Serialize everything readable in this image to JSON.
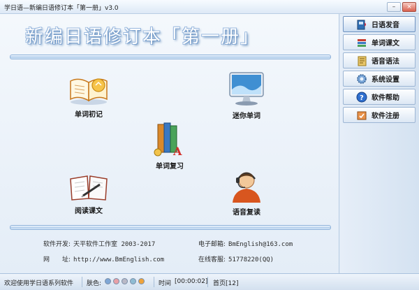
{
  "window": {
    "title": "学日语—新编日语修订本「第一册」v3.0"
  },
  "banner": {
    "text": "新编日语修订本「第一册」"
  },
  "tiles": {
    "word_learn": "单词初记",
    "mini_words": "迷你单词",
    "word_review": "单词复习",
    "reading": "阅读课文",
    "voice_review": "语音复读"
  },
  "info": {
    "developer_label": "软件开发:",
    "developer_value": "天平软件工作室 2003-2017",
    "email_label": "电子邮箱:",
    "email_value": "BmEnglish@163.com",
    "site_label": "网　　址:",
    "site_value": "http://www.BmEnglish.com",
    "support_label": "在线客服:",
    "support_value": "51778220(QQ)"
  },
  "sidebar": {
    "items": [
      {
        "label": "日语发音",
        "icon": "book-audio-icon"
      },
      {
        "label": "单词课文",
        "icon": "books-icon"
      },
      {
        "label": "语音语法",
        "icon": "notebook-icon"
      },
      {
        "label": "系统设置",
        "icon": "gear-icon"
      },
      {
        "label": "软件帮助",
        "icon": "help-icon"
      },
      {
        "label": "软件注册",
        "icon": "register-icon"
      }
    ]
  },
  "status": {
    "welcome": "欢迎使用学日语系列软件",
    "skin_label": "肤色:",
    "skin_colors": [
      "#7fa7d6",
      "#e8a0a6",
      "#b9b9c6",
      "#8fbcd3",
      "#f0a33a"
    ],
    "time_label": "时间",
    "time_value": "[00:00:02]",
    "page_label": "首页[12]"
  }
}
